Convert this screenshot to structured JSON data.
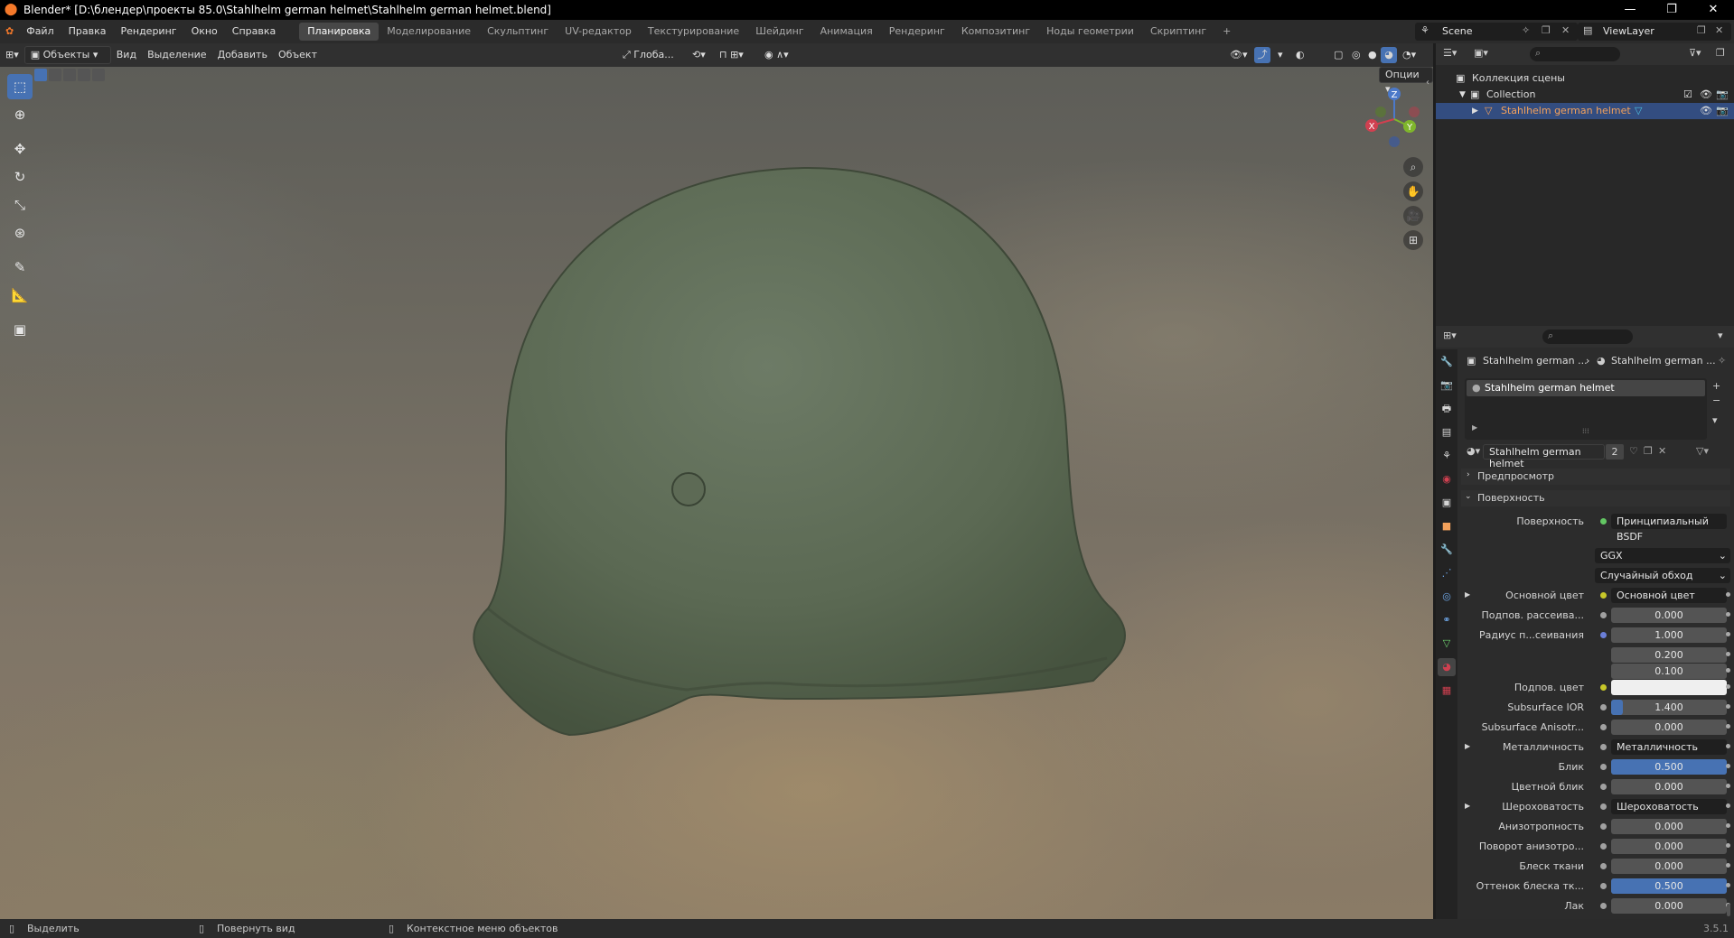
{
  "titlebar": {
    "title": "Blender* [D:\\блендер\\проекты 85.0\\Stahlhelm german helmet\\Stahlhelm german helmet.blend]",
    "minimize": "—",
    "maximize": "❐",
    "close": "✕"
  },
  "menu": {
    "items": [
      "Файл",
      "Правка",
      "Рендеринг",
      "Окно",
      "Справка"
    ],
    "workspaces": [
      "Планировка",
      "Моделирование",
      "Скульптинг",
      "UV-редактор",
      "Текстурирование",
      "Шейдинг",
      "Анимация",
      "Рендеринг",
      "Композитинг",
      "Ноды геометрии",
      "Скриптинг"
    ],
    "active_workspace": 0,
    "add_tab": "+",
    "scene": "Scene",
    "viewlayer": "ViewLayer"
  },
  "viewport_header": {
    "mode": "Объекты",
    "menus": [
      "Вид",
      "Выделение",
      "Добавить",
      "Объект"
    ],
    "transform_orient": "Глоба...",
    "options": "Опции"
  },
  "outliner": {
    "search_placeholder": "",
    "scene_collection": "Коллекция сцены",
    "collection": "Collection",
    "object": "Stahlhelm german helmet"
  },
  "properties": {
    "breadcrumb_obj": "Stahlhelm german ...",
    "breadcrumb_mat": "Stahlhelm german ...",
    "material_slot": "Stahlhelm german helmet",
    "material_name": "Stahlhelm german helmet",
    "users": "2",
    "panel_preview": "Предпросмотр",
    "panel_surface": "Поверхность",
    "surface_label": "Поверхность",
    "surface_value": "Принципиальный BSDF",
    "distribution": "GGX",
    "subsurface_method": "Случайный обход",
    "rows": [
      {
        "label": "Основной цвет",
        "value": "Основной цвет",
        "dot": "yellow",
        "kind": "link",
        "arrow": true
      },
      {
        "label": "Подпов. рассеива...",
        "value": "0.000",
        "dot": "gray",
        "kind": "num"
      },
      {
        "label": "Радиус п...сеивания",
        "value": "1.000",
        "dot": "blue",
        "kind": "num"
      },
      {
        "label": "",
        "value": "0.200",
        "dot": "",
        "kind": "num"
      },
      {
        "label": "",
        "value": "0.100",
        "dot": "",
        "kind": "num"
      },
      {
        "label": "Подпов. цвет",
        "value": "",
        "dot": "yellow",
        "kind": "color"
      },
      {
        "label": "Subsurface IOR",
        "value": "1.400",
        "dot": "gray",
        "kind": "num",
        "fill": 0.1
      },
      {
        "label": "Subsurface Anisotr...",
        "value": "0.000",
        "dot": "gray",
        "kind": "num"
      },
      {
        "label": "Металличность",
        "value": "Металличность",
        "dot": "gray",
        "kind": "link",
        "arrow": true
      },
      {
        "label": "Блик",
        "value": "0.500",
        "dot": "gray",
        "kind": "num",
        "fill": 1.0
      },
      {
        "label": "Цветной блик",
        "value": "0.000",
        "dot": "gray",
        "kind": "num"
      },
      {
        "label": "Шероховатость",
        "value": "Шероховатость",
        "dot": "gray",
        "kind": "link",
        "arrow": true
      },
      {
        "label": "Анизотропность",
        "value": "0.000",
        "dot": "gray",
        "kind": "num"
      },
      {
        "label": "Поворот анизотро...",
        "value": "0.000",
        "dot": "gray",
        "kind": "num"
      },
      {
        "label": "Блеск ткани",
        "value": "0.000",
        "dot": "gray",
        "kind": "num"
      },
      {
        "label": "Оттенок блеска тк...",
        "value": "0.500",
        "dot": "gray",
        "kind": "num",
        "fill": 1.0
      },
      {
        "label": "Лак",
        "value": "0.000",
        "dot": "gray",
        "kind": "num"
      }
    ]
  },
  "status": {
    "select": "Выделить",
    "rotate": "Повернуть вид",
    "context": "Контекстное меню объектов",
    "version": "3.5.1"
  },
  "colors": {
    "accent": "#4772b3",
    "selected_object": "#f3a15b",
    "helmet": "#5d6b55"
  }
}
